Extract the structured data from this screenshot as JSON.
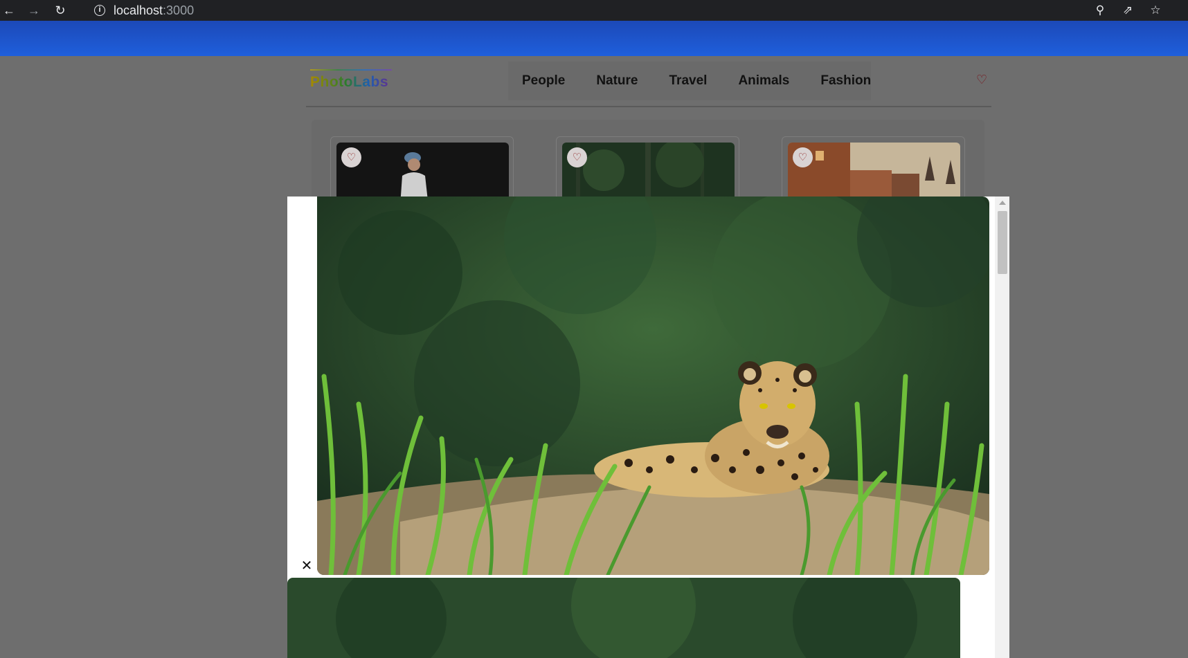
{
  "browser": {
    "back_icon": "arrow-left-icon",
    "forward_icon": "arrow-right-icon",
    "reload_icon": "reload-icon",
    "url_host": "localhost",
    "url_port": ":3000",
    "zoom_icon": "zoom-icon",
    "share_icon": "share-icon",
    "star_icon": "star-icon"
  },
  "nav": {
    "logo": "PhotoLabs",
    "topics": [
      "People",
      "Nature",
      "Travel",
      "Animals",
      "Fashion"
    ],
    "fav_icon": "heart-icon"
  },
  "photos": [
    {
      "subject": "person in cap on dark background",
      "fav_icon": "heart-icon"
    },
    {
      "subject": "dark green forest",
      "fav_icon": "heart-icon"
    },
    {
      "subject": "brick buildings and spires",
      "fav_icon": "heart-icon"
    }
  ],
  "modal": {
    "close_icon": "close-icon",
    "main_photo": "jaguar resting in tall grass",
    "colors": {
      "modal_bg": "#ffffff",
      "overlay": "#6e6e6e"
    }
  },
  "colors": {
    "chrome_bg": "#202124",
    "band_blue": "#1f5fdc",
    "heart": "#8a1a1a"
  }
}
